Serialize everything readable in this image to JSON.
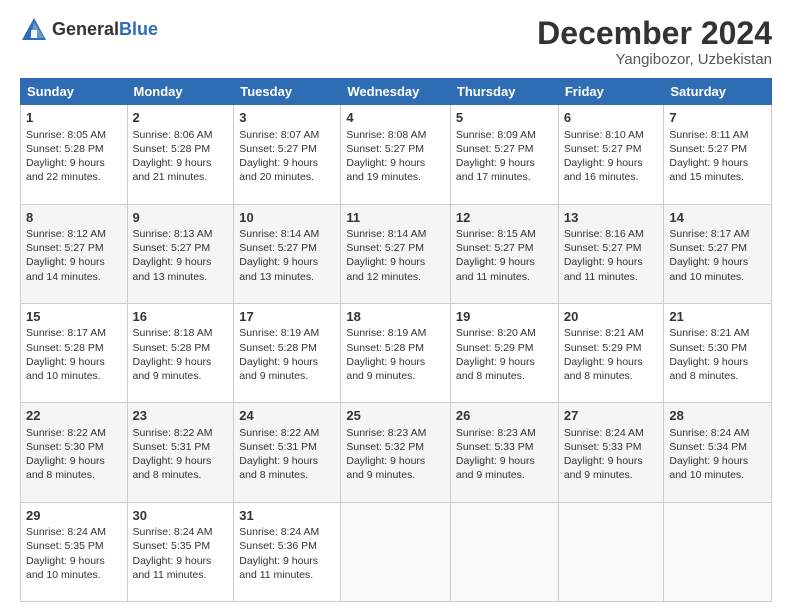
{
  "header": {
    "logo_general": "General",
    "logo_blue": "Blue",
    "month_title": "December 2024",
    "location": "Yangibozor, Uzbekistan"
  },
  "days_of_week": [
    "Sunday",
    "Monday",
    "Tuesday",
    "Wednesday",
    "Thursday",
    "Friday",
    "Saturday"
  ],
  "weeks": [
    [
      {
        "day": "1",
        "lines": [
          "Sunrise: 8:05 AM",
          "Sunset: 5:28 PM",
          "Daylight: 9 hours",
          "and 22 minutes."
        ]
      },
      {
        "day": "2",
        "lines": [
          "Sunrise: 8:06 AM",
          "Sunset: 5:28 PM",
          "Daylight: 9 hours",
          "and 21 minutes."
        ]
      },
      {
        "day": "3",
        "lines": [
          "Sunrise: 8:07 AM",
          "Sunset: 5:27 PM",
          "Daylight: 9 hours",
          "and 20 minutes."
        ]
      },
      {
        "day": "4",
        "lines": [
          "Sunrise: 8:08 AM",
          "Sunset: 5:27 PM",
          "Daylight: 9 hours",
          "and 19 minutes."
        ]
      },
      {
        "day": "5",
        "lines": [
          "Sunrise: 8:09 AM",
          "Sunset: 5:27 PM",
          "Daylight: 9 hours",
          "and 17 minutes."
        ]
      },
      {
        "day": "6",
        "lines": [
          "Sunrise: 8:10 AM",
          "Sunset: 5:27 PM",
          "Daylight: 9 hours",
          "and 16 minutes."
        ]
      },
      {
        "day": "7",
        "lines": [
          "Sunrise: 8:11 AM",
          "Sunset: 5:27 PM",
          "Daylight: 9 hours",
          "and 15 minutes."
        ]
      }
    ],
    [
      {
        "day": "8",
        "lines": [
          "Sunrise: 8:12 AM",
          "Sunset: 5:27 PM",
          "Daylight: 9 hours",
          "and 14 minutes."
        ]
      },
      {
        "day": "9",
        "lines": [
          "Sunrise: 8:13 AM",
          "Sunset: 5:27 PM",
          "Daylight: 9 hours",
          "and 13 minutes."
        ]
      },
      {
        "day": "10",
        "lines": [
          "Sunrise: 8:14 AM",
          "Sunset: 5:27 PM",
          "Daylight: 9 hours",
          "and 13 minutes."
        ]
      },
      {
        "day": "11",
        "lines": [
          "Sunrise: 8:14 AM",
          "Sunset: 5:27 PM",
          "Daylight: 9 hours",
          "and 12 minutes."
        ]
      },
      {
        "day": "12",
        "lines": [
          "Sunrise: 8:15 AM",
          "Sunset: 5:27 PM",
          "Daylight: 9 hours",
          "and 11 minutes."
        ]
      },
      {
        "day": "13",
        "lines": [
          "Sunrise: 8:16 AM",
          "Sunset: 5:27 PM",
          "Daylight: 9 hours",
          "and 11 minutes."
        ]
      },
      {
        "day": "14",
        "lines": [
          "Sunrise: 8:17 AM",
          "Sunset: 5:27 PM",
          "Daylight: 9 hours",
          "and 10 minutes."
        ]
      }
    ],
    [
      {
        "day": "15",
        "lines": [
          "Sunrise: 8:17 AM",
          "Sunset: 5:28 PM",
          "Daylight: 9 hours",
          "and 10 minutes."
        ]
      },
      {
        "day": "16",
        "lines": [
          "Sunrise: 8:18 AM",
          "Sunset: 5:28 PM",
          "Daylight: 9 hours",
          "and 9 minutes."
        ]
      },
      {
        "day": "17",
        "lines": [
          "Sunrise: 8:19 AM",
          "Sunset: 5:28 PM",
          "Daylight: 9 hours",
          "and 9 minutes."
        ]
      },
      {
        "day": "18",
        "lines": [
          "Sunrise: 8:19 AM",
          "Sunset: 5:28 PM",
          "Daylight: 9 hours",
          "and 9 minutes."
        ]
      },
      {
        "day": "19",
        "lines": [
          "Sunrise: 8:20 AM",
          "Sunset: 5:29 PM",
          "Daylight: 9 hours",
          "and 8 minutes."
        ]
      },
      {
        "day": "20",
        "lines": [
          "Sunrise: 8:21 AM",
          "Sunset: 5:29 PM",
          "Daylight: 9 hours",
          "and 8 minutes."
        ]
      },
      {
        "day": "21",
        "lines": [
          "Sunrise: 8:21 AM",
          "Sunset: 5:30 PM",
          "Daylight: 9 hours",
          "and 8 minutes."
        ]
      }
    ],
    [
      {
        "day": "22",
        "lines": [
          "Sunrise: 8:22 AM",
          "Sunset: 5:30 PM",
          "Daylight: 9 hours",
          "and 8 minutes."
        ]
      },
      {
        "day": "23",
        "lines": [
          "Sunrise: 8:22 AM",
          "Sunset: 5:31 PM",
          "Daylight: 9 hours",
          "and 8 minutes."
        ]
      },
      {
        "day": "24",
        "lines": [
          "Sunrise: 8:22 AM",
          "Sunset: 5:31 PM",
          "Daylight: 9 hours",
          "and 8 minutes."
        ]
      },
      {
        "day": "25",
        "lines": [
          "Sunrise: 8:23 AM",
          "Sunset: 5:32 PM",
          "Daylight: 9 hours",
          "and 9 minutes."
        ]
      },
      {
        "day": "26",
        "lines": [
          "Sunrise: 8:23 AM",
          "Sunset: 5:33 PM",
          "Daylight: 9 hours",
          "and 9 minutes."
        ]
      },
      {
        "day": "27",
        "lines": [
          "Sunrise: 8:24 AM",
          "Sunset: 5:33 PM",
          "Daylight: 9 hours",
          "and 9 minutes."
        ]
      },
      {
        "day": "28",
        "lines": [
          "Sunrise: 8:24 AM",
          "Sunset: 5:34 PM",
          "Daylight: 9 hours",
          "and 10 minutes."
        ]
      }
    ],
    [
      {
        "day": "29",
        "lines": [
          "Sunrise: 8:24 AM",
          "Sunset: 5:35 PM",
          "Daylight: 9 hours",
          "and 10 minutes."
        ]
      },
      {
        "day": "30",
        "lines": [
          "Sunrise: 8:24 AM",
          "Sunset: 5:35 PM",
          "Daylight: 9 hours",
          "and 11 minutes."
        ]
      },
      {
        "day": "31",
        "lines": [
          "Sunrise: 8:24 AM",
          "Sunset: 5:36 PM",
          "Daylight: 9 hours",
          "and 11 minutes."
        ]
      },
      null,
      null,
      null,
      null
    ]
  ]
}
